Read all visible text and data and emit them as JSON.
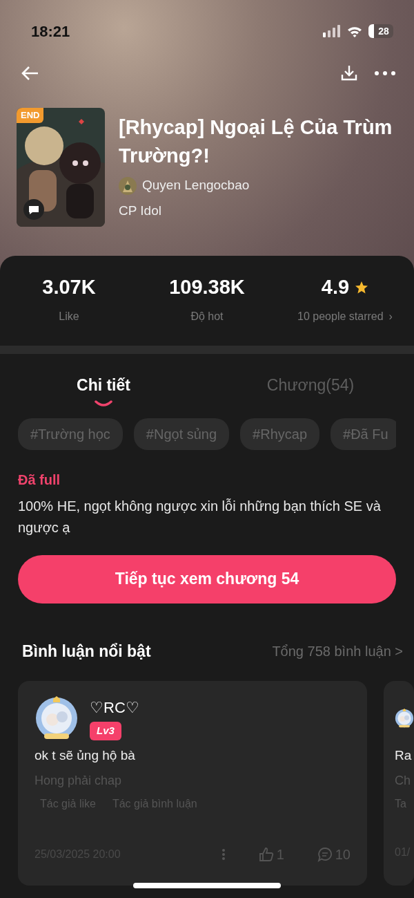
{
  "status_bar": {
    "time": "18:21",
    "battery": "28"
  },
  "book": {
    "badge": "END",
    "title": "[Rhycap] Ngoại Lệ Của Trùm Trường?!",
    "author": "Quyen Lengocbao",
    "category": "CP Idol"
  },
  "stats": [
    {
      "kind": "plain",
      "value": "3.07K",
      "label": "Like"
    },
    {
      "kind": "plain",
      "value": "109.38K",
      "label": "Độ hot"
    },
    {
      "kind": "rating",
      "value": "4.9",
      "label": "10 people starred",
      "chevron": "›"
    }
  ],
  "tabs": [
    {
      "label": "Chi tiết",
      "selected": true
    },
    {
      "label": "Chương(54)",
      "selected": false
    }
  ],
  "tags": [
    "#Trường học",
    "#Ngọt sủng",
    "#Rhycap",
    "#Đã Fu"
  ],
  "status": "Đã full",
  "description": "100% HE, ngọt không ngược xin lỗi những bạn thích SE và ngược ạ",
  "continue_button": "Tiếp tục xem chương 54",
  "comments_section": {
    "title": "Bình luận nổi bật",
    "total": "Tổng 758 bình luận >"
  },
  "comments": [
    {
      "user": "♡RC♡",
      "level": "Lv3",
      "text": "ok t sẽ ủng hộ bà",
      "chapter": "Hong phải chap",
      "badges": [
        "Tác giả like",
        "Tác giả bình luận"
      ],
      "date": "25/03/2025 20:00",
      "likes": "1",
      "replies": "10"
    },
    {
      "text": "Ra",
      "chapter": "Ch",
      "badges": [
        "Ta"
      ],
      "date": "01/"
    }
  ]
}
